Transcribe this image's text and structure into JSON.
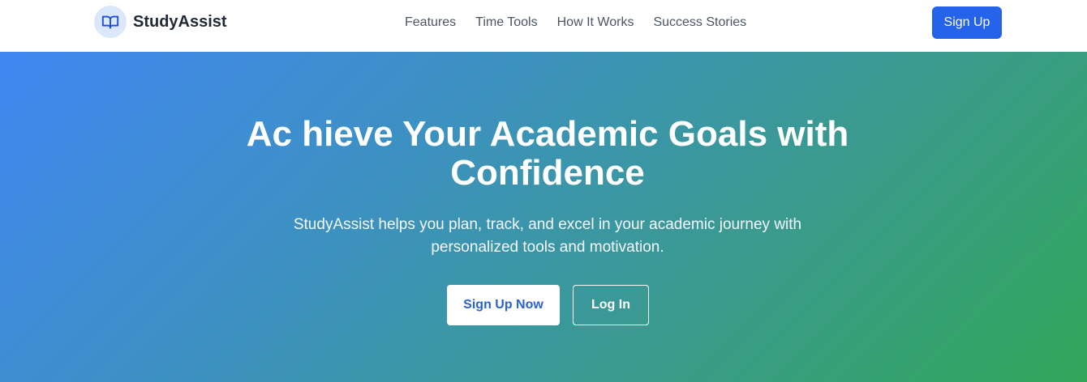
{
  "header": {
    "brand": {
      "name": "StudyAssist",
      "icon": "open-book-icon",
      "icon_color": "#1d4ed8",
      "badge_color": "#dbe7fb"
    },
    "nav": [
      {
        "label": "Features"
      },
      {
        "label": "Time Tools"
      },
      {
        "label": "How It Works"
      },
      {
        "label": "Success Stories"
      }
    ],
    "signup_label": "Sign Up",
    "signup_color": "#2563eb"
  },
  "hero": {
    "title": "Ac hieve Your Academic Goals with Confidence",
    "subtitle": "StudyAssist helps you plan, track, and excel in your academic journey with personalized tools and motivation.",
    "primary_button": "Sign Up Now",
    "secondary_button": "Log In",
    "gradient_start": "#4387f3",
    "gradient_end": "#33a65a"
  }
}
